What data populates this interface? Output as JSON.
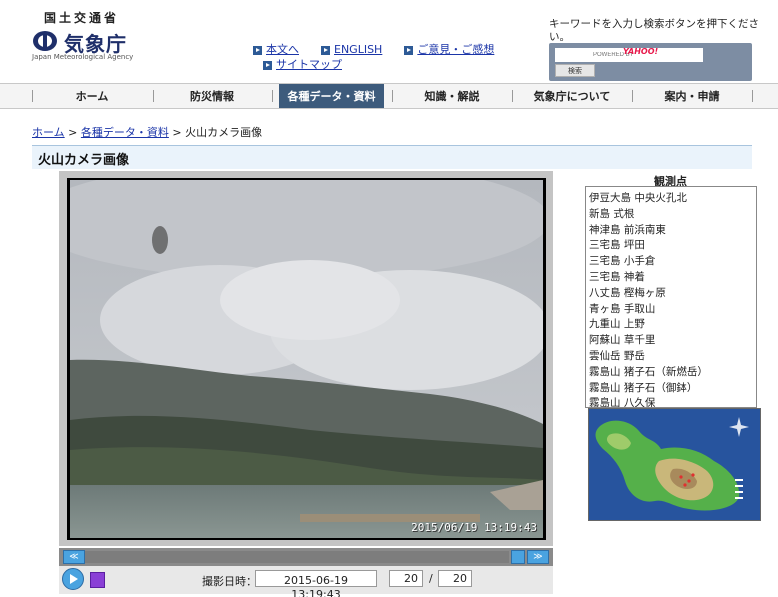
{
  "header": {
    "ministry": "国土交通省",
    "agency_name": "気象庁",
    "agency_en": "Japan Meteorological Agency",
    "links": [
      {
        "label": "本文へ"
      },
      {
        "label": "ENGLISH"
      },
      {
        "label": "ご意見・ご感想"
      },
      {
        "label": "サイトマップ"
      }
    ],
    "search_hint": "キーワードを入力し検索ボタンを押下ください。",
    "search_placeholder": "POWERED BY",
    "search_brand": "YAHOO!",
    "search_button": "検索"
  },
  "nav": {
    "items": [
      {
        "label": "ホーム"
      },
      {
        "label": "防災情報"
      },
      {
        "label": "各種データ・資料"
      },
      {
        "label": "知識・解説"
      },
      {
        "label": "気象庁について"
      },
      {
        "label": "案内・申請"
      }
    ],
    "active_index": 2
  },
  "breadcrumb": {
    "home": "ホーム",
    "sep": " > ",
    "data": "各種データ・資料",
    "current": "火山カメラ画像"
  },
  "page_title": "火山カメラ画像",
  "camera": {
    "timestamp": "2015/06/19 13:19:43"
  },
  "controls": {
    "prev_label": "≪",
    "next_label": "≫",
    "shot_label": "撮影日時：",
    "shot_datetime": "2015-06-19　13:19:43",
    "frame_current": "20",
    "frame_sep": "/",
    "frame_total": "20"
  },
  "stations": {
    "title": "観測点",
    "items": [
      "伊豆大島 中央火孔北",
      "新島 式根",
      "神津島 前浜南東",
      "三宅島 坪田",
      "三宅島 小手倉",
      "三宅島 神着",
      "八丈島 樫梅ヶ原",
      "青ヶ島 手取山",
      "九重山 上野",
      "阿蘇山 草千里",
      "雲仙岳 野岳",
      "霧島山 猪子石（新燃岳）",
      "霧島山 猪子石（御鉢）",
      "霧島山 八久保"
    ]
  },
  "colors": {
    "nav_active": "#3d5b7c",
    "title_bar": "#eaf3fb",
    "map_sea": "#27549e"
  }
}
